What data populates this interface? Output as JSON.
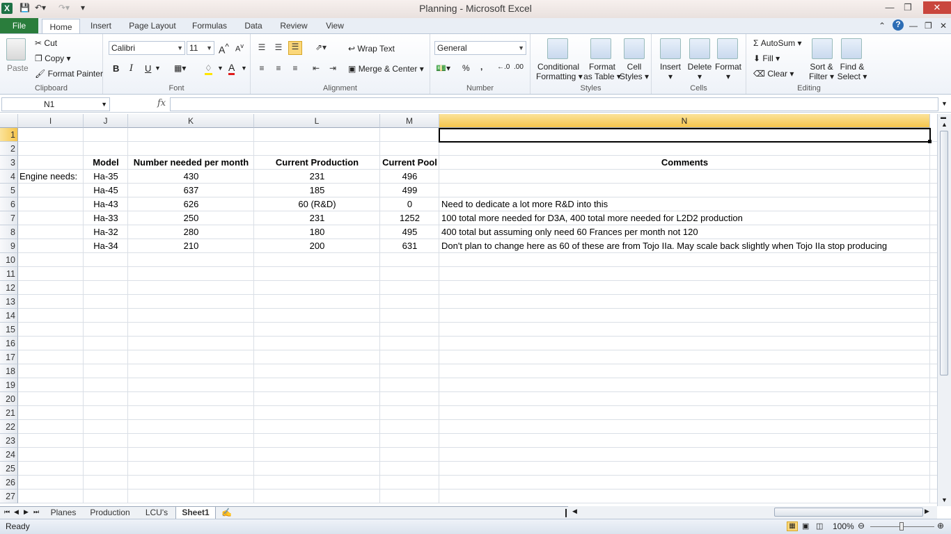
{
  "window": {
    "title": "Planning  -  Microsoft Excel",
    "logo": "X"
  },
  "ribbon_tabs": [
    "File",
    "Home",
    "Insert",
    "Page Layout",
    "Formulas",
    "Data",
    "Review",
    "View"
  ],
  "clipboard": {
    "paste": "Paste",
    "cut": "Cut",
    "copy": "Copy",
    "format_painter": "Format Painter",
    "label": "Clipboard"
  },
  "font": {
    "name": "Calibri",
    "size": "11",
    "label": "Font",
    "bold": "B",
    "italic": "I",
    "underline": "U"
  },
  "alignment": {
    "wrap": "Wrap Text",
    "merge": "Merge & Center",
    "label": "Alignment"
  },
  "number": {
    "format": "General",
    "pct": "%",
    "comma": ",",
    "label": "Number"
  },
  "styles": {
    "cond1": "Conditional",
    "cond2": "Formatting",
    "fmt1": "Format",
    "fmt2": "as Table",
    "cell1": "Cell",
    "cell2": "Styles",
    "label": "Styles"
  },
  "cells": {
    "insert": "Insert",
    "delete": "Delete",
    "format": "Format",
    "label": "Cells"
  },
  "editing": {
    "autosum": "AutoSum",
    "fill": "Fill",
    "clear": "Clear",
    "sort1": "Sort &",
    "sort2": "Filter",
    "find1": "Find &",
    "find2": "Select",
    "label": "Editing"
  },
  "formula_bar": {
    "name_box": "N1",
    "fx": "fx",
    "value": ""
  },
  "columns": [
    "I",
    "J",
    "K",
    "L",
    "M",
    "N"
  ],
  "rows": [
    "1",
    "2",
    "3",
    "4",
    "5",
    "6",
    "7",
    "8",
    "9",
    "10",
    "11",
    "12",
    "13",
    "14",
    "15",
    "16",
    "17",
    "18",
    "19",
    "20",
    "21",
    "22",
    "23",
    "24",
    "25",
    "26",
    "27"
  ],
  "sheet": {
    "header": {
      "model": "Model",
      "needed": "Number needed per month",
      "production": "Current Production",
      "pool": "Current Pool",
      "comments": "Comments"
    },
    "label_engine": "Engine needs:",
    "data": [
      {
        "model": "Ha-35",
        "needed": "430",
        "production": "231",
        "pool": "496",
        "comment": ""
      },
      {
        "model": "Ha-45",
        "needed": "637",
        "production": "185",
        "pool": "499",
        "comment": ""
      },
      {
        "model": "Ha-43",
        "needed": "626",
        "production": "60 (R&D)",
        "pool": "0",
        "comment": "Need to dedicate a lot more R&D into this"
      },
      {
        "model": "Ha-33",
        "needed": "250",
        "production": "231",
        "pool": "1252",
        "comment": "100 total more needed for D3A,  400 total more needed for L2D2 production"
      },
      {
        "model": "Ha-32",
        "needed": "280",
        "production": "180",
        "pool": "495",
        "comment": "400 total but assuming only need 60 Frances per month not 120"
      },
      {
        "model": "Ha-34",
        "needed": "210",
        "production": "200",
        "pool": "631",
        "comment": "Don't plan to change here as 60 of these are from Tojo IIa. May scale back slightly when Tojo IIa stop producing"
      }
    ]
  },
  "sheet_tabs": [
    "Planes",
    "Production",
    "LCU's",
    "Sheet1"
  ],
  "status": {
    "ready": "Ready",
    "zoom": "100%"
  }
}
